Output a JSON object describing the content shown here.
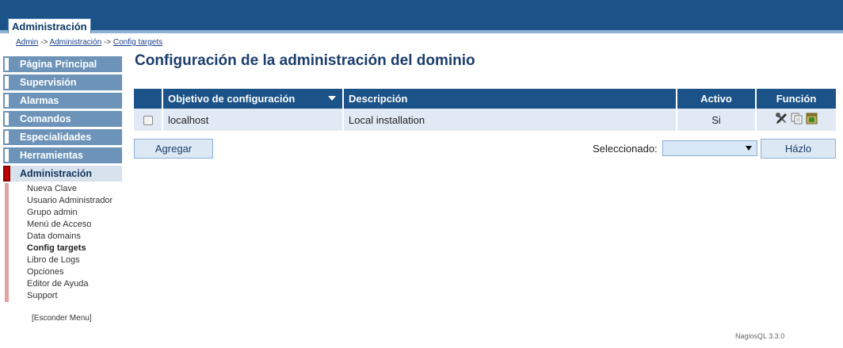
{
  "header": {
    "tab_label": "Administración"
  },
  "breadcrumb": {
    "items": [
      "Admin",
      "Administración",
      "Config targets"
    ],
    "separator": "->"
  },
  "sidebar": {
    "menu": [
      {
        "label": "Página Principal"
      },
      {
        "label": "Supervisión"
      },
      {
        "label": "Alarmas"
      },
      {
        "label": "Comandos"
      },
      {
        "label": "Especialidades"
      },
      {
        "label": "Herramientas"
      },
      {
        "label": "Administración"
      }
    ],
    "submenu": [
      "Nueva Clave",
      "Usuario Administrador",
      "Grupo admin",
      "Menú de Acceso",
      "Data domains",
      "Config targets",
      "Libro de Logs",
      "Opciones",
      "Editor de Ayuda",
      "Support"
    ],
    "hide_menu": "[Esconder Menu]"
  },
  "main": {
    "title": "Configuración de la administración del dominio",
    "table": {
      "headers": [
        "Objetivo de configuración",
        "Descripción",
        "Activo",
        "Función"
      ],
      "rows": [
        {
          "target": "localhost",
          "description": "Local installation",
          "active": "Si"
        }
      ]
    },
    "add_button": "Agregar",
    "selected_label": "Seleccionado:",
    "select_value": "",
    "do_button": "Házlo"
  },
  "footer": {
    "version": "NagiosQL 3.3.0"
  },
  "colors": {
    "header_bg": "#1b5287",
    "menu_bg": "#6d93b8",
    "row_bg": "#e1eaf4",
    "active_marker": "#c40000"
  },
  "icons": {
    "row_functions": [
      "tools-icon",
      "copy-icon",
      "info-icon"
    ]
  }
}
